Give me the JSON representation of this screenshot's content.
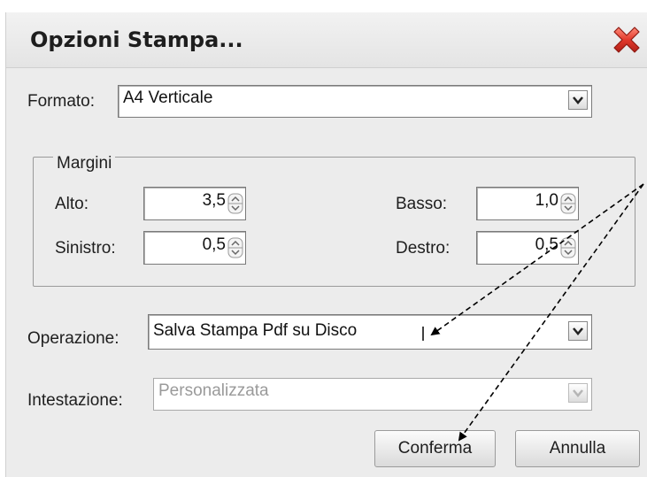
{
  "dialog": {
    "title": "Opzioni Stampa...",
    "close_icon": "close-icon"
  },
  "formato": {
    "label": "Formato:",
    "value": "A4 Verticale"
  },
  "margini": {
    "legend": "Margini",
    "alto": {
      "label": "Alto:",
      "value": "3,5"
    },
    "basso": {
      "label": "Basso:",
      "value": "1,0"
    },
    "sinistro": {
      "label": "Sinistro:",
      "value": "0,5"
    },
    "destro": {
      "label": "Destro:",
      "value": "0,5"
    }
  },
  "operazione": {
    "label": "Operazione:",
    "value": "Salva Stampa Pdf su Disco"
  },
  "intestazione": {
    "label": "Intestazione:",
    "value": "Personalizzata",
    "enabled": false
  },
  "buttons": {
    "confirm": "Conferma",
    "cancel": "Annulla"
  },
  "annotation": {
    "icon": "dashed-arrows",
    "color": "#000000"
  }
}
